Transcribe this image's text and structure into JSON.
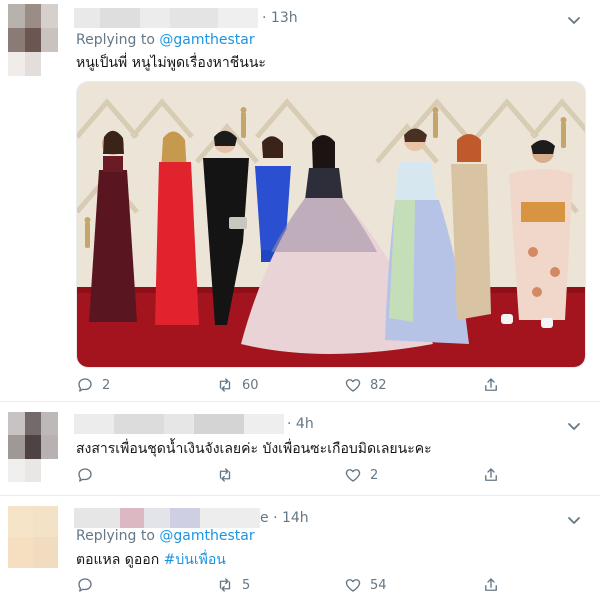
{
  "tweets": [
    {
      "time": "13h",
      "reply_prefix": "Replying to",
      "reply_handle": "@gamthestar",
      "text": "หนูเป็นพี่ หนูไม่พูดเรื่องหาชีนนะ",
      "has_media": true,
      "replies": "2",
      "retweets": "60",
      "likes": "82"
    },
    {
      "time": "4h",
      "text": "สงสารเพื่อนชุดน้ำเงินจังเลยค่ะ บังเพื่อนซะเกือบมิดเลยนะคะ",
      "replies": "",
      "retweets": "",
      "likes": "2"
    },
    {
      "time": "14h",
      "time_prefix": "e ·",
      "reply_prefix": "Replying to",
      "reply_handle": "@gamthestar",
      "text_plain": "ตอแหล ดูออก",
      "text_hashtag": "#บ่นเพื่อน",
      "replies": "",
      "retweets": "5",
      "likes": "54"
    }
  ],
  "icons": {
    "reply": "reply-icon",
    "retweet": "retweet-icon",
    "like": "heart-icon",
    "share": "share-icon",
    "more": "chevron-down-icon"
  },
  "colors": {
    "link": "#1b95e0",
    "secondary_text": "#657786",
    "divider": "#e6ecf0"
  }
}
